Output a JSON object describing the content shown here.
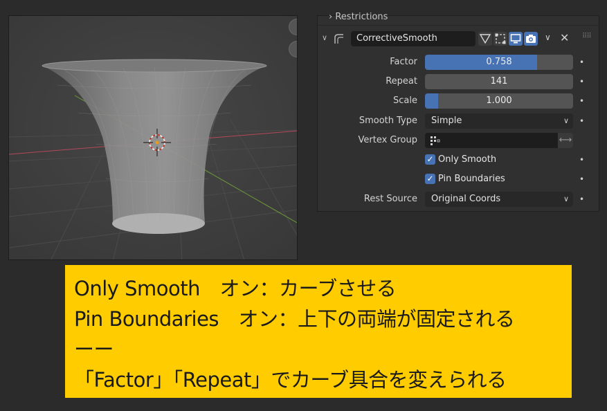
{
  "viewport": {
    "colors": {
      "background": "#3e3e3e",
      "mesh": "#8a8a8a",
      "x_axis": "#b5485a",
      "y_axis": "#6f9a3a",
      "grid": "#4a4a4a"
    }
  },
  "panel": {
    "restrictions_label": "Restrictions",
    "modifier_name": "CorrectiveSmooth",
    "properties": {
      "factor": {
        "label": "Factor",
        "value": "0.758",
        "fraction": 0.758
      },
      "repeat": {
        "label": "Repeat",
        "value": "141",
        "fraction": 0
      },
      "scale": {
        "label": "Scale",
        "value": "1.000",
        "fraction": 0.09
      },
      "smooth_type": {
        "label": "Smooth Type",
        "value": "Simple"
      },
      "vertex_group": {
        "label": "Vertex Group",
        "value": ""
      },
      "only_smooth": {
        "label": "Only Smooth",
        "checked": true
      },
      "pin_boundaries": {
        "label": "Pin Boundaries",
        "checked": true
      },
      "rest_source": {
        "label": "Rest Source",
        "value": "Original Coords"
      }
    },
    "colors": {
      "accent": "#4772b3",
      "field": "#545454",
      "panel": "#303030"
    }
  },
  "note": {
    "line1": "Only Smooth　オン：カーブさせる",
    "line2": "Pin Boundaries　オン：上下の両端が固定される",
    "line3": "ーー",
    "line4": "「Factor」「Repeat」でカーブ具合を変えられる",
    "background": "#ffcc00"
  }
}
